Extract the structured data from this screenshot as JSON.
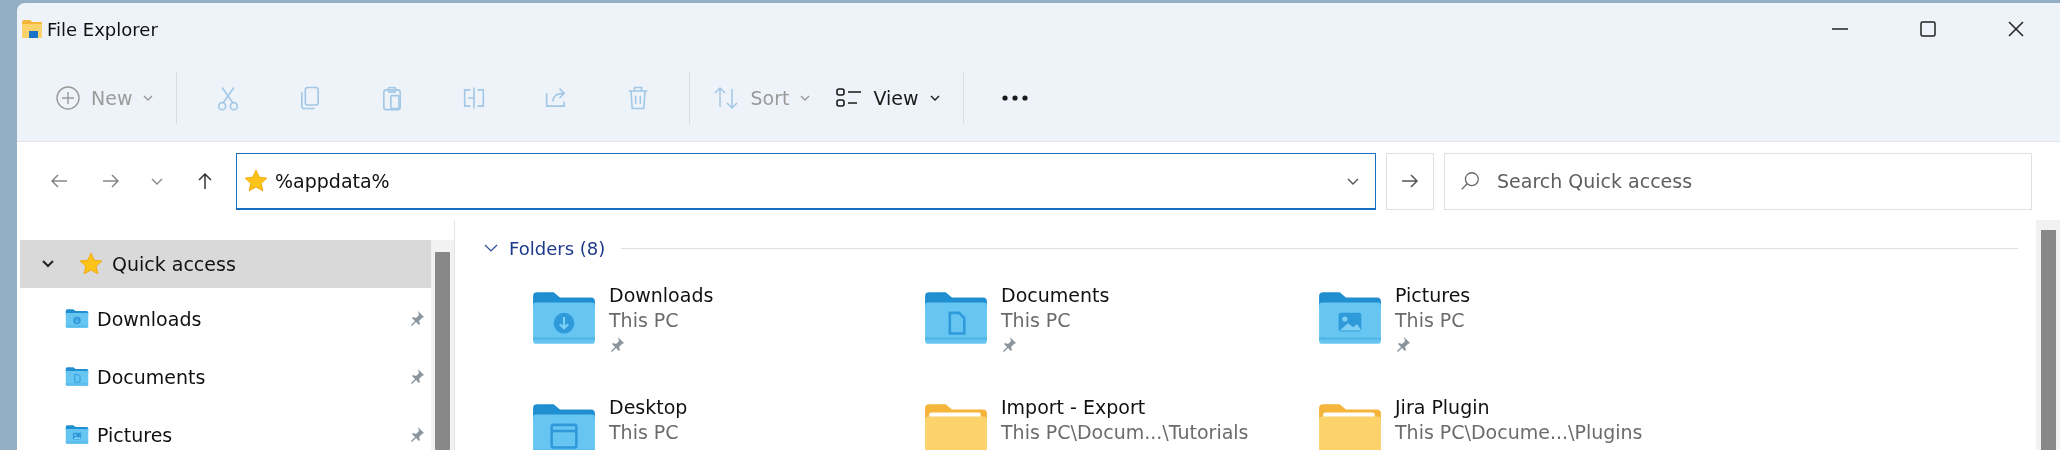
{
  "window": {
    "title": "File Explorer"
  },
  "toolbar": {
    "items": [
      {
        "kind": "new",
        "label": "New",
        "disabled": true
      },
      {
        "kind": "cut",
        "disabled": true
      },
      {
        "kind": "copy",
        "disabled": true
      },
      {
        "kind": "paste",
        "disabled": true
      },
      {
        "kind": "rename",
        "disabled": true
      },
      {
        "kind": "share",
        "disabled": true
      },
      {
        "kind": "delete",
        "disabled": true
      },
      {
        "kind": "sort",
        "label": "Sort",
        "disabled": true
      },
      {
        "kind": "view",
        "label": "View",
        "disabled": false
      },
      {
        "kind": "more",
        "disabled": false
      }
    ]
  },
  "address": {
    "value": "%appdata%"
  },
  "search": {
    "placeholder": "Search Quick access"
  },
  "sidebar": {
    "items": [
      {
        "label": "Quick access",
        "kind": "quick",
        "expanded": true,
        "selected": true,
        "children": [
          {
            "label": "Downloads",
            "kind": "downloads",
            "pinned": true,
            "selected": false
          },
          {
            "label": "Documents",
            "kind": "documents",
            "pinned": true,
            "selected": false
          },
          {
            "label": "Pictures",
            "kind": "pictures",
            "pinned": true,
            "selected": false
          }
        ]
      }
    ]
  },
  "content": {
    "group": {
      "label": "Folders (8)",
      "expanded": true
    },
    "folders": [
      {
        "name": "Downloads",
        "location": "This PC",
        "kind": "downloads",
        "pinned": true
      },
      {
        "name": "Documents",
        "location": "This PC",
        "kind": "documents",
        "pinned": true
      },
      {
        "name": "Pictures",
        "location": "This PC",
        "kind": "pictures",
        "pinned": true
      },
      {
        "name": "Desktop",
        "location": "This PC",
        "kind": "desktop"
      },
      {
        "name": "Import - Export",
        "location": "This PC\\Docum...\\Tutorials",
        "kind": "folder"
      },
      {
        "name": "Jira Plugin",
        "location": "This PC\\Docume...\\Plugins",
        "kind": "folder"
      }
    ]
  }
}
